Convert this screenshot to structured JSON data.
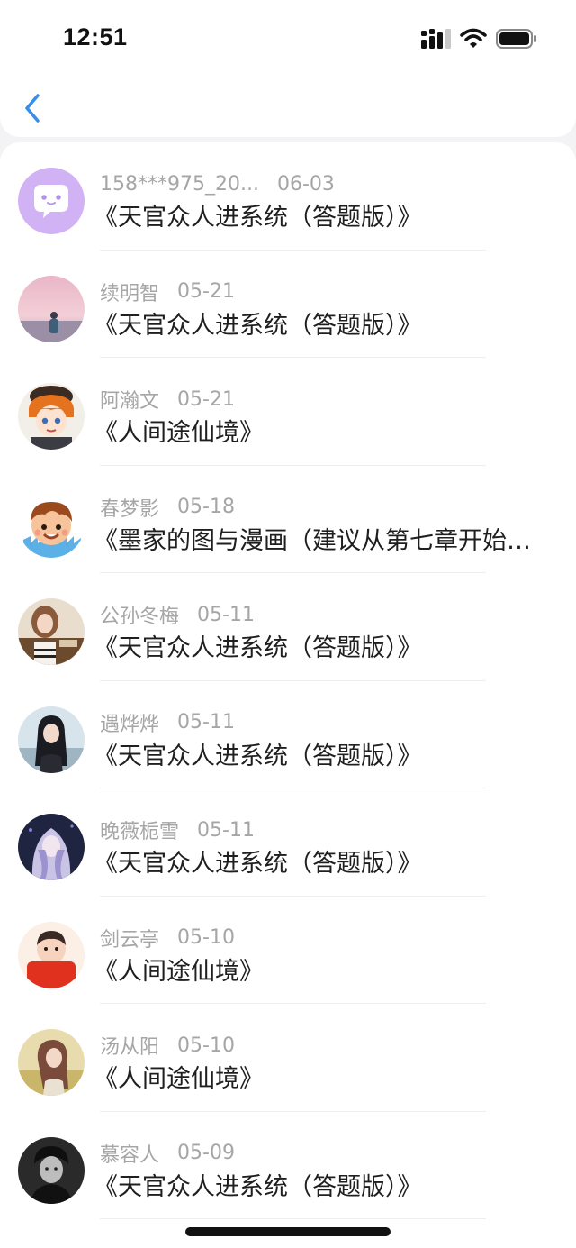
{
  "status_bar": {
    "time": "12:51",
    "icons": [
      "signal-icon",
      "wifi-icon",
      "battery-icon"
    ]
  },
  "nav": {
    "back_icon": "chevron-left-icon",
    "accent_color": "#3a8ee6"
  },
  "items": [
    {
      "user": "158***975_20...",
      "date": "06-03",
      "title": "《天官众人进系统（答题版）》",
      "avatar": "purple-chat-avatar"
    },
    {
      "user": "续明智",
      "date": "05-21",
      "title": "《天官众人进系统（答题版）》",
      "avatar": "pink-sky-avatar"
    },
    {
      "user": "阿瀚文",
      "date": "05-21",
      "title": "《人间途仙境》",
      "avatar": "anime-boy-avatar"
    },
    {
      "user": "春梦影",
      "date": "05-18",
      "title": "《墨家的图与漫画（建议从第七章开始阅读）》",
      "avatar": "cartoon-boy-avatar"
    },
    {
      "user": "公孙冬梅",
      "date": "05-11",
      "title": "《天官众人进系统（答题版）》",
      "avatar": "girl-photo-avatar"
    },
    {
      "user": "遇烨烨",
      "date": "05-11",
      "title": "《天官众人进系统（答题版）》",
      "avatar": "girl-dark-hair-avatar"
    },
    {
      "user": "晚薇栀雪",
      "date": "05-11",
      "title": "《天官众人进系统（答题版）》",
      "avatar": "anime-girl-avatar"
    },
    {
      "user": "剑云亭",
      "date": "05-10",
      "title": "《人间途仙境》",
      "avatar": "red-scarf-avatar"
    },
    {
      "user": "汤从阳",
      "date": "05-10",
      "title": "《人间途仙境》",
      "avatar": "golden-girl-avatar"
    },
    {
      "user": "慕容人",
      "date": "05-09",
      "title": "《天官众人进系统（答题版）》",
      "avatar": "bw-portrait-avatar"
    }
  ]
}
